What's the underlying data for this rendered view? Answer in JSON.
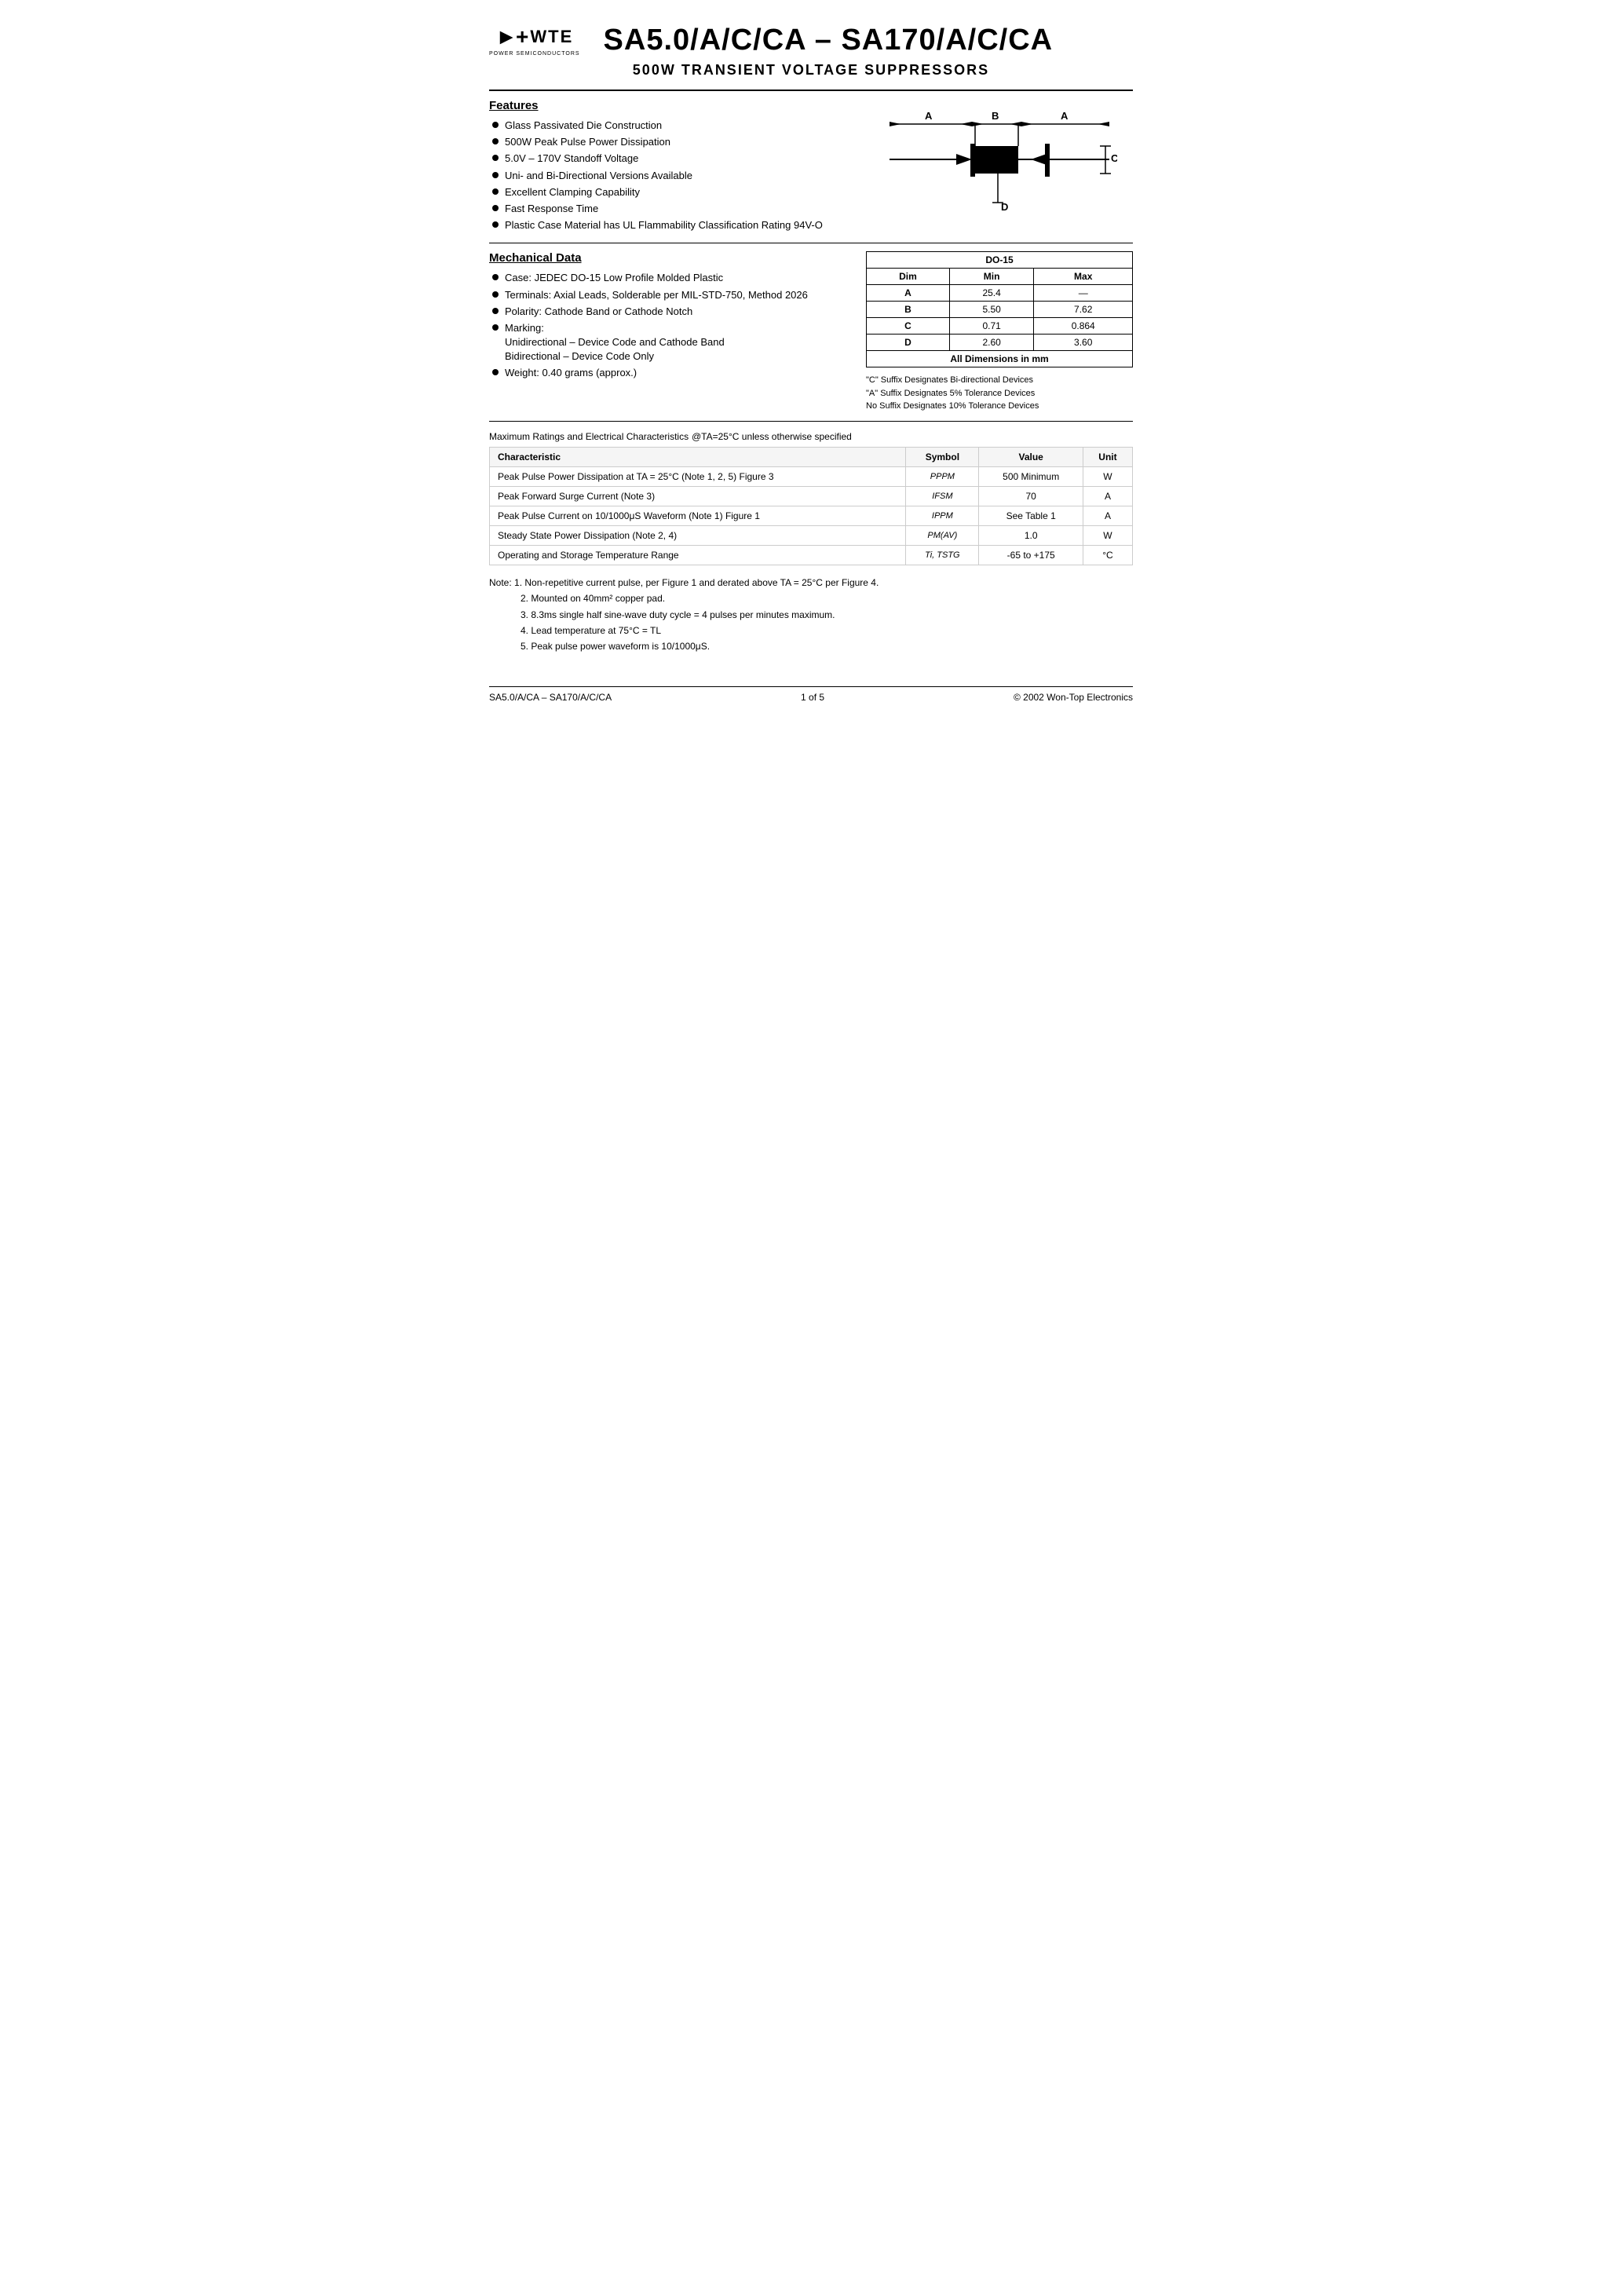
{
  "header": {
    "logo_text": "WTE",
    "logo_sub": "POWER SEMICONDUCTORS",
    "main_title": "SA5.0/A/C/CA – SA170/A/C/CA",
    "sub_title": "500W TRANSIENT VOLTAGE SUPPRESSORS"
  },
  "features": {
    "title": "Features",
    "items": [
      "Glass Passivated Die Construction",
      "500W Peak Pulse Power Dissipation",
      "5.0V – 170V Standoff Voltage",
      "Uni- and Bi-Directional Versions Available",
      "Excellent Clamping Capability",
      "Fast Response Time",
      "Plastic Case Material has UL Flammability Classification Rating 94V-O"
    ]
  },
  "mechanical": {
    "title": "Mechanical Data",
    "items": [
      "Case: JEDEC DO-15 Low Profile Molded Plastic",
      "Terminals: Axial Leads, Solderable per MIL-STD-750, Method 2026",
      "Polarity: Cathode Band or Cathode Notch",
      "Marking:",
      "Unidirectional – Device Code and Cathode Band",
      "Bidirectional – Device Code Only",
      "Weight: 0.40 grams (approx.)"
    ]
  },
  "dimensions_table": {
    "title": "DO-15",
    "headers": [
      "Dim",
      "Min",
      "Max"
    ],
    "rows": [
      {
        "dim": "A",
        "min": "25.4",
        "max": "—"
      },
      {
        "dim": "B",
        "min": "5.50",
        "max": "7.62"
      },
      {
        "dim": "C",
        "min": "0.71",
        "max": "0.864"
      },
      {
        "dim": "D",
        "min": "2.60",
        "max": "3.60"
      }
    ],
    "footer": "All Dimensions in mm"
  },
  "suffix_notes": [
    "\"C\" Suffix Designates Bi-directional Devices",
    "\"A\" Suffix Designates 5% Tolerance Devices",
    "No Suffix Designates 10% Tolerance Devices"
  ],
  "max_ratings": {
    "title": "Maximum Ratings and Electrical Characteristics",
    "condition": "@TA=25°C unless otherwise specified",
    "table_headers": [
      "Characteristic",
      "Symbol",
      "Value",
      "Unit"
    ],
    "rows": [
      {
        "characteristic": "Peak Pulse Power Dissipation at TA = 25°C (Note 1, 2, 5) Figure 3",
        "symbol": "PPPM",
        "value": "500 Minimum",
        "unit": "W"
      },
      {
        "characteristic": "Peak Forward Surge Current (Note 3)",
        "symbol": "IFSM",
        "value": "70",
        "unit": "A"
      },
      {
        "characteristic": "Peak Pulse Current on 10/1000μS Waveform (Note 1) Figure 1",
        "symbol": "IPPM",
        "value": "See Table 1",
        "unit": "A"
      },
      {
        "characteristic": "Steady State Power Dissipation (Note 2, 4)",
        "symbol": "PM(AV)",
        "value": "1.0",
        "unit": "W"
      },
      {
        "characteristic": "Operating and Storage Temperature Range",
        "symbol": "Ti, TSTG",
        "value": "-65 to +175",
        "unit": "°C"
      }
    ]
  },
  "notes": {
    "intro": "Note:",
    "items": [
      "1. Non-repetitive current pulse, per Figure 1 and derated above TA = 25°C per Figure 4.",
      "2. Mounted on 40mm² copper pad.",
      "3. 8.3ms single half sine-wave duty cycle = 4 pulses per minutes maximum.",
      "4. Lead temperature at 75°C = TL",
      "5. Peak pulse power waveform is 10/1000μS."
    ]
  },
  "footer": {
    "left": "SA5.0/A/CA – SA170/A/C/CA",
    "center": "1 of 5",
    "right": "© 2002 Won-Top Electronics"
  }
}
